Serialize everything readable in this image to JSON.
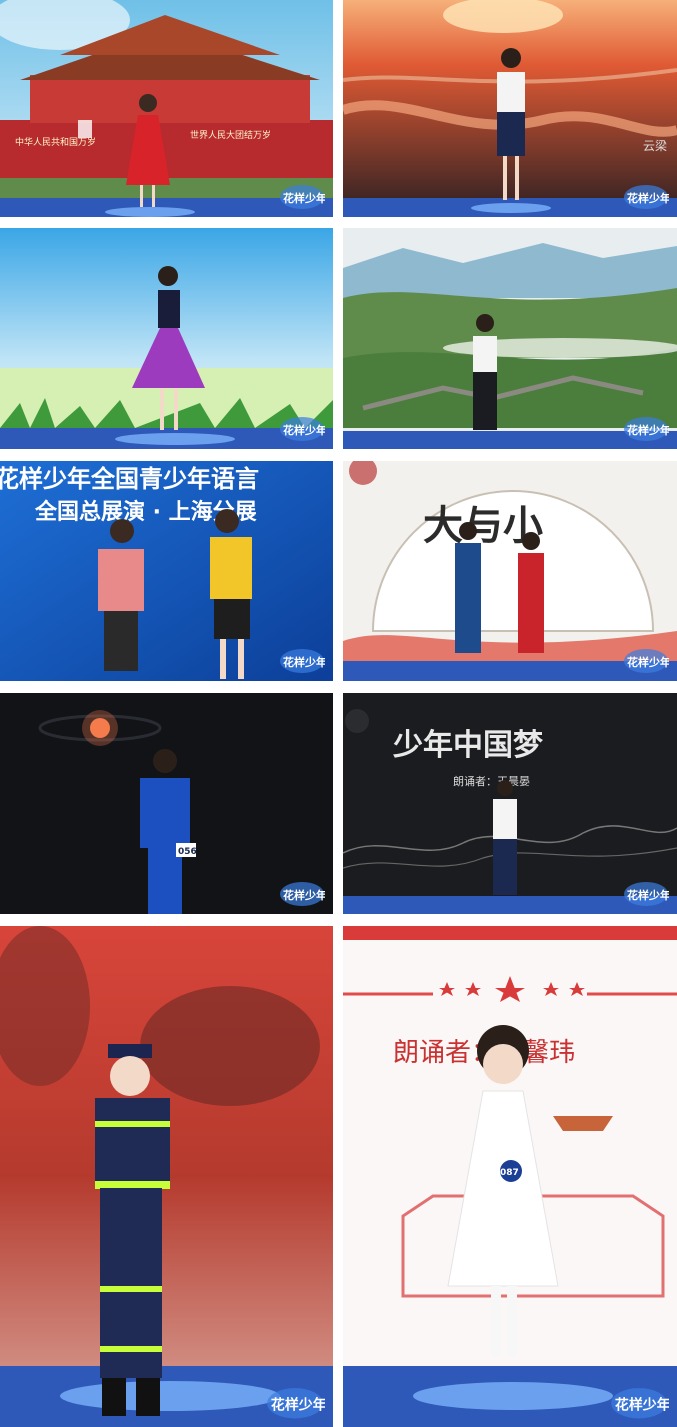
{
  "watermark": "花样少年",
  "photos": [
    {
      "id": "p1",
      "scene": "tiananmen",
      "banner_left": "中华人民共和国万岁",
      "banner_right": "世界人民大团结万岁"
    },
    {
      "id": "p2",
      "scene": "river-sunset",
      "caption": "云梁"
    },
    {
      "id": "p3",
      "scene": "meadow"
    },
    {
      "id": "p4",
      "scene": "great-wall"
    },
    {
      "id": "p5",
      "scene": "blue-banner",
      "line1": "花样少年全国青少年语言",
      "line2": "全国总展演 · 上海分展"
    },
    {
      "id": "p6",
      "scene": "fan",
      "title": "大与小"
    },
    {
      "id": "p7",
      "scene": "dark-stage",
      "badge": "056"
    },
    {
      "id": "p8",
      "scene": "dream",
      "title": "少年中国梦",
      "subtitle": "朗诵者：王晨晏"
    },
    {
      "id": "p9",
      "scene": "firefighter"
    },
    {
      "id": "p10",
      "scene": "red-white",
      "title": "朗诵者：臧馨玮",
      "badge": "087"
    }
  ]
}
